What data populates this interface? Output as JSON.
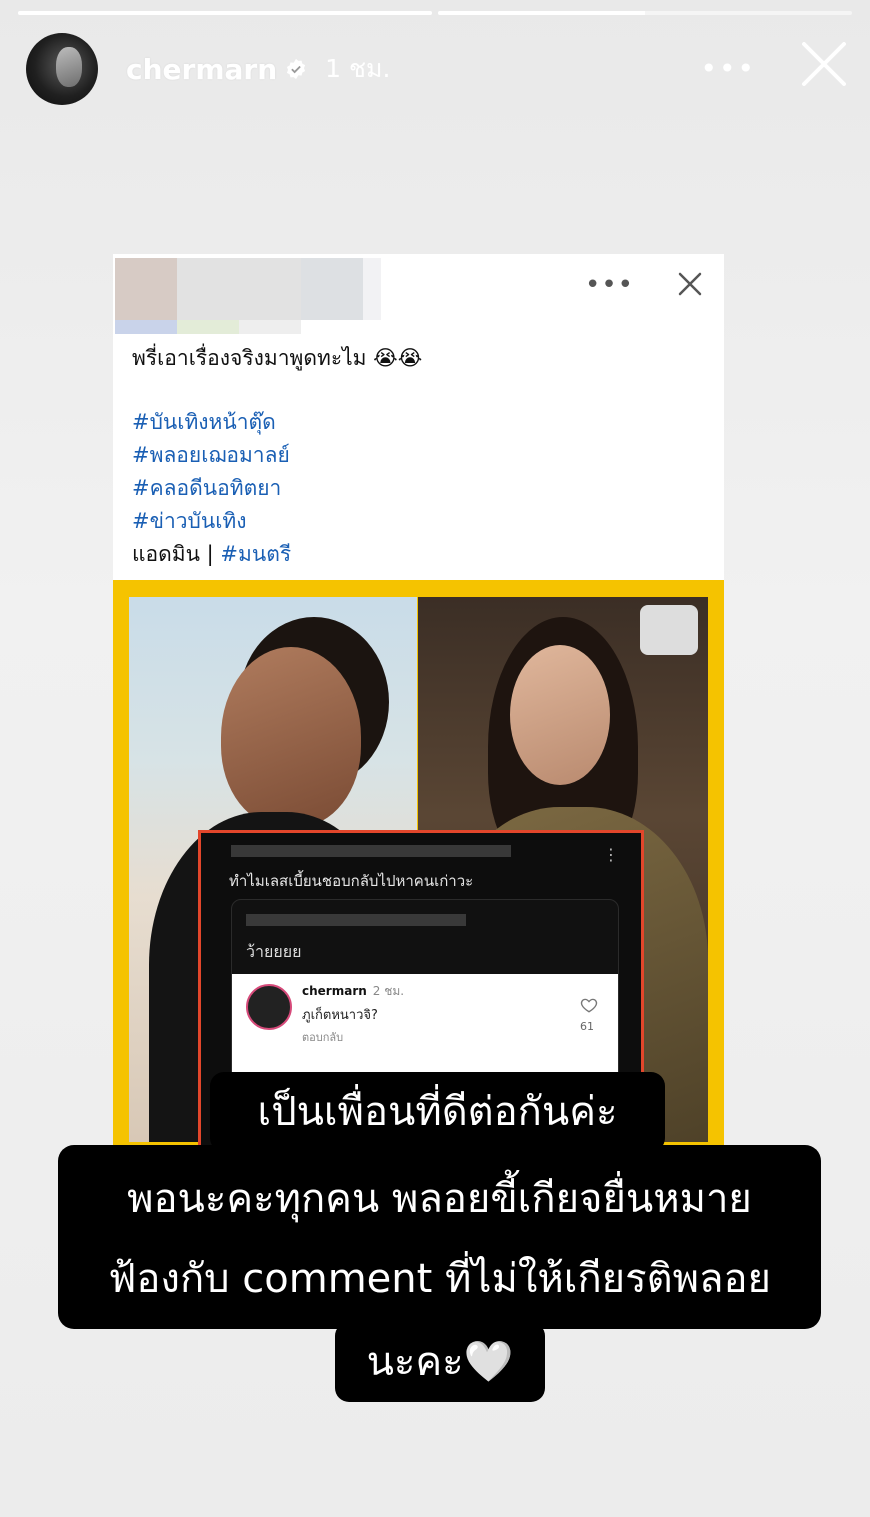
{
  "story": {
    "progress": [
      1.0,
      0.5
    ],
    "username": "chermarn",
    "time": "1 ชม.",
    "more_icon": "more-horizontal-icon",
    "close_icon": "close-icon"
  },
  "post": {
    "caption": "พรี่เอาเรื่องจริงมาพูดทะไม 😭😭",
    "hashtags": [
      "#บันเทิงหน้าตุ๊ด",
      "#พลอยเฌอมาลย์",
      "#คลอดีนอทิตยา",
      "#ข่าวบันเทิง"
    ],
    "admin_label": "แอดมิน | ",
    "admin_tag": "#มนตรี"
  },
  "inner": {
    "question": "ทำไมเลสเบี้ยนชอบกลับไปหาคนเก่าวะ",
    "reply_prefix": "ว้ายยยย",
    "reply_user": "chermarn",
    "reply_time": "2 ชม.",
    "reply_text": "ภูเก็ตหนาวจิ?",
    "reply_action": "ตอบกลับ",
    "reply_likes": "61"
  },
  "overlay": {
    "line1": "เป็นเพื่อนที่ดีต่อกันค่ะ",
    "line2": "พอนะคะทุกคน พลอยขี้เกียจยื่นหมาย",
    "line3": "ฟ้องกับ comment ที่ไม่ให้เกียรติพลอย",
    "line4": "นะคะ🤍"
  },
  "colors": {
    "frame": "#f5c300",
    "inner_border": "#e2462b",
    "hashtag": "#1a5fb4"
  }
}
